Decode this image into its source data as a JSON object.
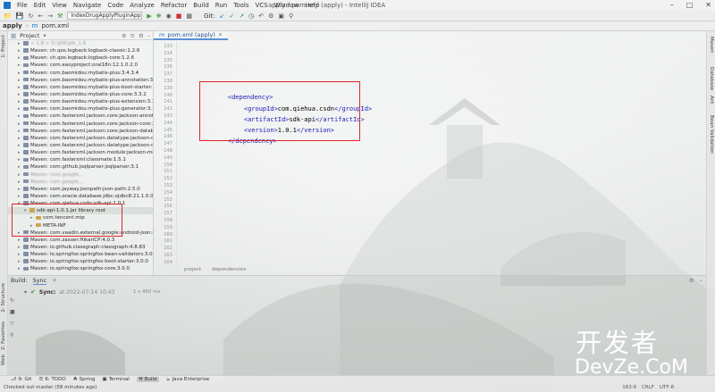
{
  "menubar": {
    "items": [
      "File",
      "Edit",
      "View",
      "Navigate",
      "Code",
      "Analyze",
      "Refactor",
      "Build",
      "Run",
      "Tools",
      "VCS",
      "Window",
      "Help"
    ],
    "window_title": "apply - pom.xml (apply) - IntelliJ IDEA"
  },
  "toolbar": {
    "run_config": "IndexDrugApplyPluginApplication",
    "git_label": "Git:"
  },
  "navbar": {
    "project": "apply",
    "file": "pom.xml"
  },
  "left_stripe": {
    "tabs": [
      "1: Project",
      "2: Structure",
      "2: Favorites",
      "Web"
    ]
  },
  "right_stripe": {
    "tabs": [
      "Maven",
      "Database",
      "Ant",
      "Bean Validation"
    ]
  },
  "project_panel": {
    "header": "Project",
    "rows": [
      {
        "text": "< 1.8 > D:\\JDK\\jdk_1.8",
        "indent": 1,
        "expand": "closed",
        "blurred": true
      },
      {
        "text": "Maven: ch.qos.logback:logback-classic:1.2.6",
        "indent": 1,
        "expand": "closed",
        "blurred": false
      },
      {
        "text": "Maven: ch.qos.logback:logback-core:1.2.6",
        "indent": 1,
        "expand": "closed",
        "blurred": false
      },
      {
        "text": "Maven: com.easyproject:oral18n:12.1.0.2.0",
        "indent": 1,
        "expand": "closed",
        "blurred": false
      },
      {
        "text": "Maven: com.baomidou:mybatis-plus:3.4.3.4",
        "indent": 1,
        "expand": "closed",
        "blurred": false
      },
      {
        "text": "Maven: com.baomidou:mybatis-plus-annotation:3.3.2",
        "indent": 1,
        "expand": "closed",
        "blurred": false
      },
      {
        "text": "Maven: com.baomidou:mybatis-plus-boot-starter:3.4.3.4",
        "indent": 1,
        "expand": "closed",
        "blurred": false
      },
      {
        "text": "Maven: com.baomidou:mybatis-plus-core:3.3.2",
        "indent": 1,
        "expand": "closed",
        "blurred": false
      },
      {
        "text": "Maven: com.baomidou:mybatis-plus-extension:3.3.2",
        "indent": 1,
        "expand": "closed",
        "blurred": false
      },
      {
        "text": "Maven: com.baomidou:mybatis-plus-generator:3.3.2",
        "indent": 1,
        "expand": "closed",
        "blurred": false
      },
      {
        "text": "Maven: com.fasterxml.jackson.core:jackson-annotations:2",
        "indent": 1,
        "expand": "closed",
        "blurred": false
      },
      {
        "text": "Maven: com.fasterxml.jackson.core:jackson-core:2.12.5",
        "indent": 1,
        "expand": "closed",
        "blurred": false
      },
      {
        "text": "Maven: com.fasterxml.jackson.core:jackson-databind:2.12",
        "indent": 1,
        "expand": "closed",
        "blurred": false
      },
      {
        "text": "Maven: com.fasterxml.jackson.datatype:jackson-datatype",
        "indent": 1,
        "expand": "closed",
        "blurred": false
      },
      {
        "text": "Maven: com.fasterxml.jackson.datatype:jackson-datatype",
        "indent": 1,
        "expand": "closed",
        "blurred": false
      },
      {
        "text": "Maven: com.fasterxml.jackson.module:jackson-module-p",
        "indent": 1,
        "expand": "closed",
        "blurred": false
      },
      {
        "text": "Maven: com.fasterxml:classmate:1.5.1",
        "indent": 1,
        "expand": "closed",
        "blurred": false
      },
      {
        "text": "Maven: com.github.jsqlparser:jsqlparser:3.1",
        "indent": 1,
        "expand": "closed",
        "blurred": false
      },
      {
        "text": "Maven: com.google...",
        "indent": 1,
        "expand": "closed",
        "blurred": true
      },
      {
        "text": "Maven: com.google...",
        "indent": 1,
        "expand": "closed",
        "blurred": true
      },
      {
        "text": "Maven: com.jayway.jsonpath:json-path:2.5.0",
        "indent": 1,
        "expand": "closed",
        "blurred": false
      },
      {
        "text": "Maven: com.oracle.database.jdbc:ojdbc8:21.1.0.0",
        "indent": 1,
        "expand": "closed",
        "blurred": false
      },
      {
        "text": "Maven: com.qiehua.csdn:sdk-api:1.0.1",
        "indent": 1,
        "expand": "open",
        "blurred": false
      },
      {
        "text": "sdk-api-1.0.1.jar  library root",
        "indent": 2,
        "expand": "open",
        "blurred": false,
        "selected": true
      },
      {
        "text": "com.tencent.mip",
        "indent": 3,
        "expand": "closed",
        "blurred": false
      },
      {
        "text": "META-INF",
        "indent": 3,
        "expand": "closed",
        "blurred": false
      },
      {
        "text": "Maven: com.vaadin.external.google:android-json:0.0.201",
        "indent": 1,
        "expand": "closed",
        "blurred": false
      },
      {
        "text": "Maven: com.zaxxer:HikariCP:4.0.3",
        "indent": 1,
        "expand": "closed",
        "blurred": false
      },
      {
        "text": "Maven: io.github.classgraph:classgraph:4.8.83",
        "indent": 1,
        "expand": "closed",
        "blurred": false
      },
      {
        "text": "Maven: io.springfox:springfox-bean-validators:3.0.0",
        "indent": 1,
        "expand": "closed",
        "blurred": false
      },
      {
        "text": "Maven: io.springfox:springfox-boot-starter:3.0.0",
        "indent": 1,
        "expand": "closed",
        "blurred": false
      },
      {
        "text": "Maven: io.springfox:springfox-core:3.0.0",
        "indent": 1,
        "expand": "closed",
        "blurred": false
      }
    ]
  },
  "editor": {
    "tab_label": "pom.xml (apply)",
    "line_numbers": [
      "133",
      "134",
      "135",
      "136",
      "137",
      "138",
      "139",
      "140",
      "141",
      "142",
      "143",
      "144",
      "145",
      "146",
      "147",
      "148",
      "149",
      "150",
      "151",
      "152",
      "153",
      "154",
      "155",
      "156",
      "157",
      "158",
      "159",
      "160",
      "161",
      "162",
      "163",
      "164"
    ],
    "code": {
      "line1_tag_open": "<dependency>",
      "line2_tag_open": "<groupId>",
      "line2_value": "com.qiehua.csdn",
      "line2_tag_close": "</groupId>",
      "line3_tag_open": "<artifactId>",
      "line3_value": "sdk-api",
      "line3_tag_close": "</artifactId>",
      "line4_tag_open": "<version>",
      "line4_value": "1.0.1",
      "line4_tag_close": "</version>",
      "line5_tag_close": "</dependency>"
    },
    "breadcrumb": [
      "project",
      "dependencies"
    ]
  },
  "build_panel": {
    "header_label": "Build:",
    "tab_label": "Sync",
    "sync_title": "Sync:",
    "sync_at": "at 2022-07-14 10:43",
    "sync_duration": "1 s 460 ms"
  },
  "tool_strip": {
    "items": [
      {
        "label": "9: Git",
        "active": false
      },
      {
        "label": "6: TODO",
        "active": false
      },
      {
        "label": "Spring",
        "active": false
      },
      {
        "label": "Terminal",
        "active": false
      },
      {
        "label": "Build",
        "active": true
      },
      {
        "label": "Java Enterprise",
        "active": false
      }
    ]
  },
  "statusbar": {
    "message": "Checked out master (58 minutes ago)",
    "right_items": [
      "163:9",
      "CRLF",
      "UTF-8"
    ]
  },
  "watermark": {
    "chinese": "开发者",
    "english": "DevZe.CoM"
  }
}
